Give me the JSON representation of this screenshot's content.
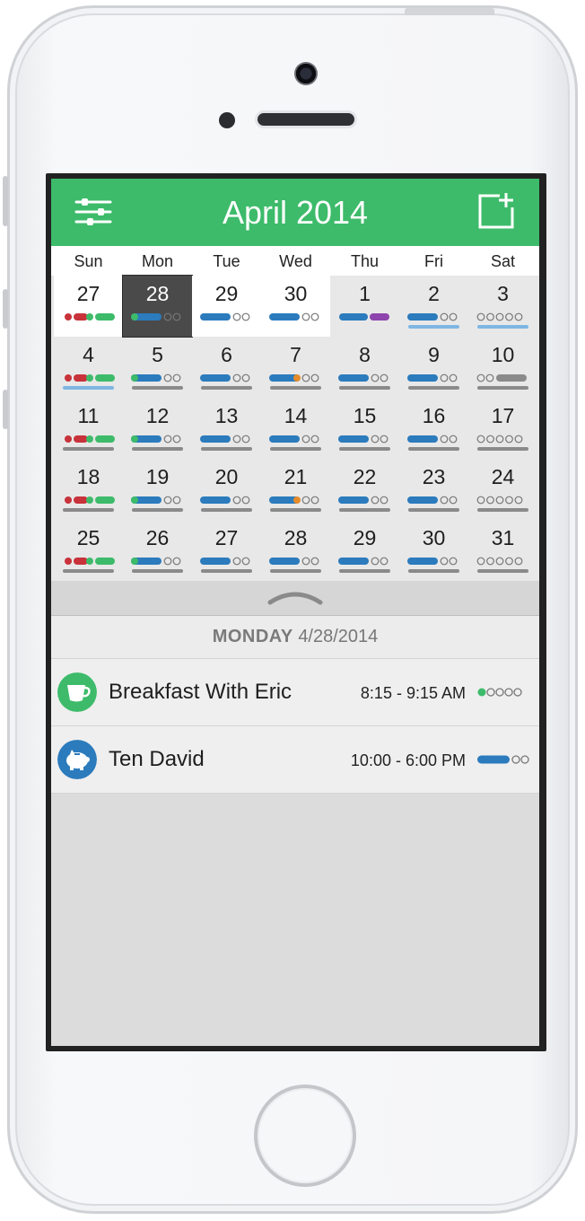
{
  "header": {
    "title": "April 2014",
    "menu_icon": "sliders-icon",
    "add_icon": "add-event-icon",
    "background": "#3dbb6a"
  },
  "weekdays": [
    "Sun",
    "Mon",
    "Tue",
    "Wed",
    "Thu",
    "Fri",
    "Sat"
  ],
  "calendar": {
    "weeks": [
      [
        "27",
        "28",
        "29",
        "30",
        "1",
        "2",
        "3"
      ],
      [
        "4",
        "5",
        "6",
        "7",
        "8",
        "9",
        "10"
      ],
      [
        "11",
        "12",
        "13",
        "14",
        "15",
        "16",
        "17"
      ],
      [
        "18",
        "19",
        "20",
        "21",
        "22",
        "23",
        "24"
      ],
      [
        "25",
        "26",
        "27",
        "28",
        "29",
        "30",
        "31"
      ]
    ],
    "selected": "28"
  },
  "day_panel": {
    "weekday_label": "MONDAY",
    "date_label": "4/28/2014",
    "pull_icon": "chevron-up-icon"
  },
  "events": [
    {
      "title": "Breakfast With Eric",
      "time": "8:15 - 9:15 AM",
      "icon": "coffee-cup-icon",
      "color": "#3dbb6a"
    },
    {
      "title": "Ten David",
      "time": "10:00 - 6:00 PM",
      "icon": "piggy-bank-icon",
      "color": "#2b7bbd"
    }
  ],
  "colors": {
    "blue": "#2b7bbd",
    "green": "#3dbb6a",
    "red": "#c8323a",
    "purple": "#8e44ad",
    "orange": "#e58b2a",
    "gray": "#8a8a8a",
    "light_blue": "#7fb6e3"
  }
}
